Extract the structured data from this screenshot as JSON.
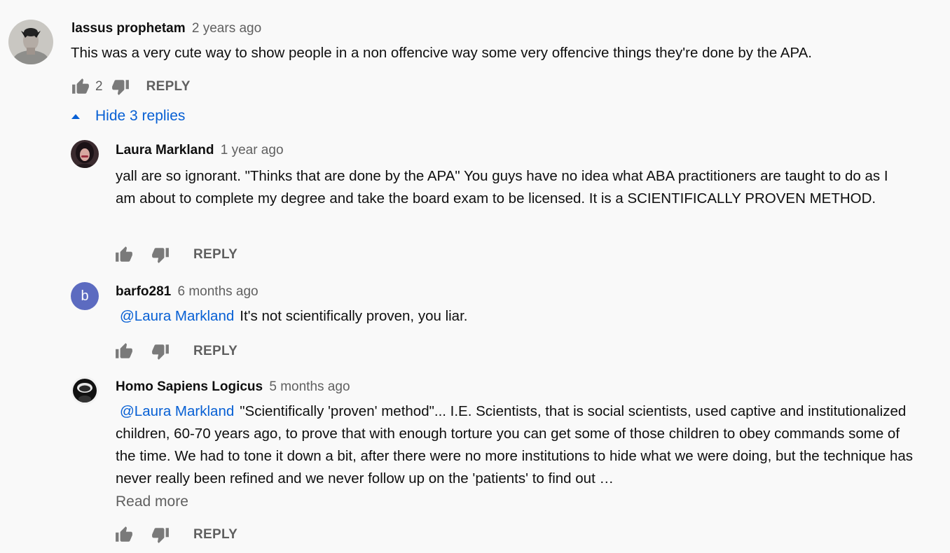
{
  "comment": {
    "author": "lassus prophetam",
    "time": "2 years ago",
    "text": "This was a very cute way to show people in a non offencive way some very offencive things they're done by the APA.",
    "likes": "2",
    "reply_label": "REPLY",
    "avatar_icon": "portrait-avatar-icon"
  },
  "replies_toggle": {
    "label": "Hide 3 replies",
    "icon": "caret-up-icon",
    "color": "#065fd4"
  },
  "replies": [
    {
      "author": "Laura Markland",
      "time": "1 year ago",
      "text": "yall are so ignorant. \"Thinks that are done by the APA\" You guys have no idea what ABA practitioners are taught to do as I am about to complete my degree and take the board exam to be licensed. It is a SCIENTIFICALLY PROVEN METHOD.",
      "reply_label": "REPLY",
      "avatar_icon": "photo-avatar-icon"
    },
    {
      "author": "barfo281",
      "time": "6 months ago",
      "avatar_letter": "b",
      "avatar_color": "#5c6bc0",
      "mention": "@Laura Markland",
      "text": "It's not scientifically proven, you liar.",
      "reply_label": "REPLY"
    },
    {
      "author": "Homo Sapiens Logicus",
      "time": "5 months ago",
      "mention": "@Laura Markland",
      "text": "\"Scientifically 'proven' method\"... I.E. Scientists, that is social scientists, used captive and institutionalized children, 60-70 years ago, to prove that with enough torture you can get some of those children to obey commands some of the time. We had to tone it down a bit, after there were no more institutions to hide what we were doing, but the technique has never really been refined and we never follow up on the 'patients' to find out …",
      "read_more": "Read more",
      "reply_label": "REPLY",
      "avatar_icon": "astronaut-avatar-icon"
    }
  ]
}
